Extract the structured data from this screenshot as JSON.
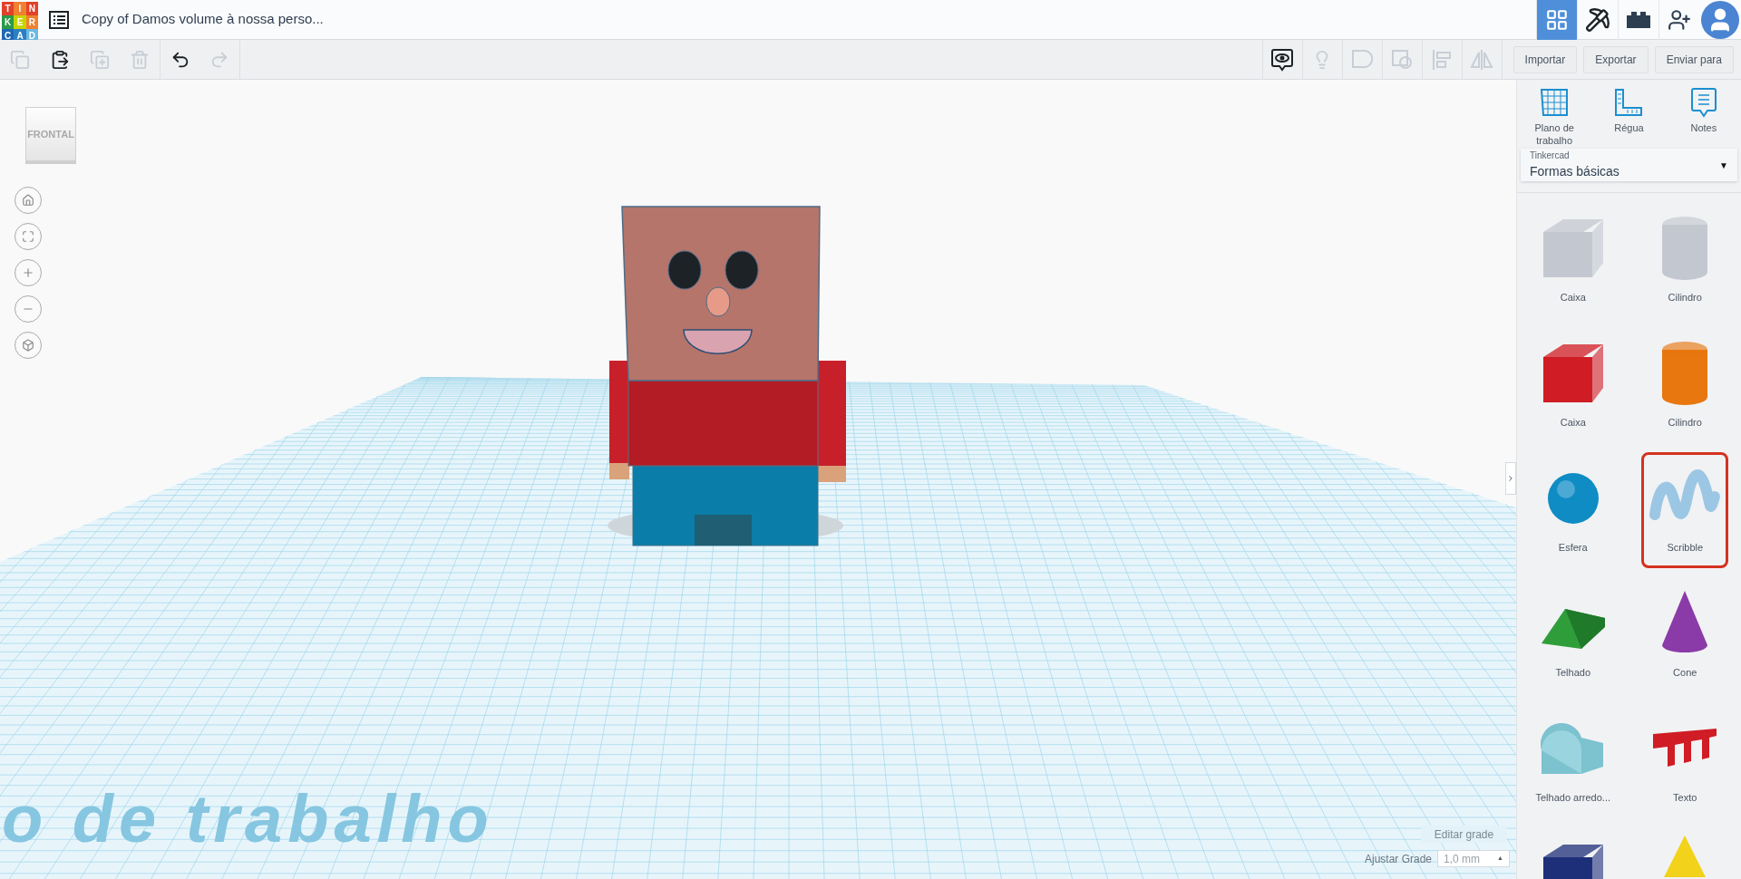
{
  "header": {
    "logo_letters": [
      {
        "text": "T",
        "color": "#e2412a"
      },
      {
        "text": "I",
        "color": "#f1812f"
      },
      {
        "text": "N",
        "color": "#e2412a"
      },
      {
        "text": "K",
        "color": "#2b9a47"
      },
      {
        "text": "E",
        "color": "#c7d400"
      },
      {
        "text": "R",
        "color": "#f1812f"
      },
      {
        "text": "C",
        "color": "#1f68b3"
      },
      {
        "text": "A",
        "color": "#2d7fc1"
      },
      {
        "text": "D",
        "color": "#6cb9e2"
      }
    ],
    "title": "Copy of Damos volume à nossa perso...",
    "views": [
      {
        "kind": "grid",
        "selected": true
      },
      {
        "kind": "pickaxe",
        "selected": false
      },
      {
        "kind": "brick",
        "selected": false
      }
    ]
  },
  "toolbar": {
    "left": [
      {
        "kind": "copy",
        "disabled": true
      },
      {
        "kind": "paste",
        "disabled": false
      },
      {
        "kind": "duplicate",
        "disabled": true
      },
      {
        "kind": "delete",
        "disabled": true
      },
      {
        "kind": "undo",
        "disabled": false
      },
      {
        "kind": "redo",
        "disabled": true
      }
    ],
    "right": [
      {
        "kind": "notes",
        "disabled": false
      },
      {
        "kind": "light",
        "disabled": true
      },
      {
        "kind": "group",
        "disabled": true
      },
      {
        "kind": "ungroup",
        "disabled": true
      },
      {
        "kind": "align",
        "disabled": true
      },
      {
        "kind": "mirror",
        "disabled": true
      }
    ],
    "buttons": [
      "Importar",
      "Exportar",
      "Enviar para"
    ]
  },
  "viewport": {
    "view_cube": "FRONTAL",
    "workplane_label": "o de trabalho",
    "edit_grid": "Editar grade",
    "snap_label": "Ajustar Grade",
    "snap_value": "1,0 mm",
    "snap_caret": "▲"
  },
  "panel": {
    "tools": [
      {
        "kind": "workplane",
        "label": "Plano de trabalho"
      },
      {
        "kind": "ruler",
        "label": "Régua"
      },
      {
        "kind": "notes",
        "label": "Notes"
      }
    ],
    "library_source": "Tinkercad",
    "library": "Formas básicas",
    "library_caret": "▼",
    "shapes": [
      {
        "kind": "box",
        "label": "Caixa",
        "color": "#c3c8d0",
        "selected": false
      },
      {
        "kind": "cylinder",
        "label": "Cilindro",
        "color": "#c3c8d0",
        "selected": false
      },
      {
        "kind": "box",
        "label": "Caixa",
        "color": "#d01c24",
        "selected": false
      },
      {
        "kind": "cylinder",
        "label": "Cilindro",
        "color": "#e8770f",
        "selected": false
      },
      {
        "kind": "sphere",
        "label": "Esfera",
        "color": "#0f8cc4",
        "selected": false
      },
      {
        "kind": "scribble",
        "label": "Scribble",
        "color": "#9cc7e4",
        "selected": true
      },
      {
        "kind": "roof",
        "label": "Telhado",
        "color": "#2f9e3a",
        "selected": false
      },
      {
        "kind": "cone",
        "label": "Cone",
        "color": "#8a3ba8",
        "selected": false
      },
      {
        "kind": "rounded_roof",
        "label": "Telhado arredo...",
        "color": "#7cc2cf",
        "selected": false
      },
      {
        "kind": "text",
        "label": "Texto",
        "color": "#d01c24",
        "selected": false
      },
      {
        "kind": "box",
        "color": "#1e2f7a",
        "selected": false
      },
      {
        "kind": "pyramid",
        "color": "#f2d21a",
        "selected": false
      }
    ]
  }
}
